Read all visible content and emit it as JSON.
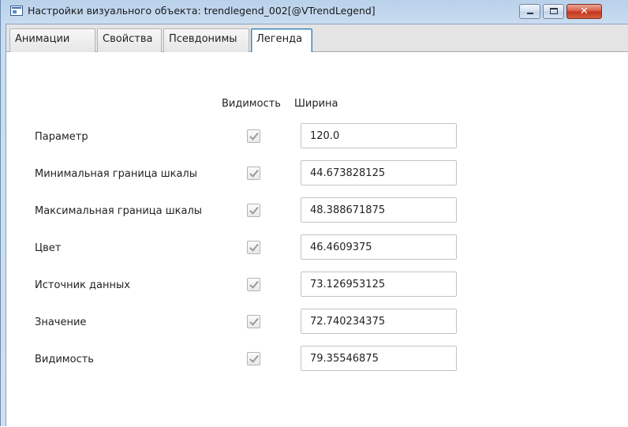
{
  "window": {
    "title": "Настройки визуального объекта: trendlegend_002[@VTrendLegend]",
    "close_glyph": "✕"
  },
  "tabs": [
    {
      "label": "Анимации"
    },
    {
      "label": "Свойства"
    },
    {
      "label": "Псевдонимы"
    },
    {
      "label": "Легенда",
      "active": true
    }
  ],
  "legend": {
    "header_visibility": "Видимость",
    "header_width": "Ширина",
    "rows": [
      {
        "label": "Параметр",
        "visible": true,
        "width": "120.0"
      },
      {
        "label": "Минимальная граница шкалы",
        "visible": true,
        "width": "44.673828125"
      },
      {
        "label": "Максимальная граница шкалы",
        "visible": true,
        "width": "48.388671875"
      },
      {
        "label": "Цвет",
        "visible": true,
        "width": "46.4609375"
      },
      {
        "label": "Источник данных",
        "visible": true,
        "width": "73.126953125"
      },
      {
        "label": "Значение",
        "visible": true,
        "width": "72.740234375"
      },
      {
        "label": "Видимость",
        "visible": true,
        "width": "79.35546875"
      }
    ]
  },
  "icons": {
    "app": "app-window-icon",
    "minimize": "minimize-icon",
    "maximize": "maximize-icon",
    "close": "close-icon",
    "check": "check-icon"
  },
  "colors": {
    "titlebar": "#b9d1ea",
    "active_tab_border": "#3c7fb1",
    "close_button": "#d8553e"
  }
}
